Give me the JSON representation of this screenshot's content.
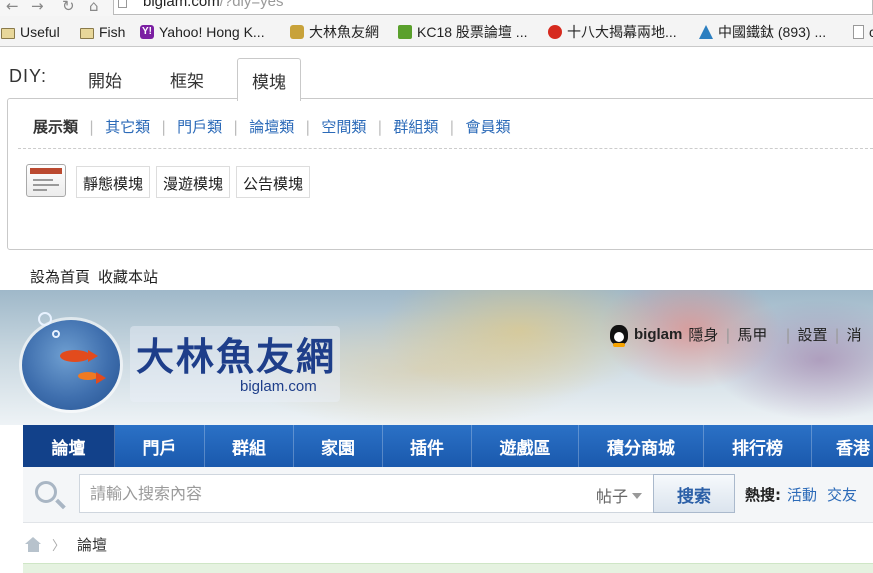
{
  "browser": {
    "url_host": "biglam.com",
    "url_rest": "/?diy=yes",
    "bookmarks": [
      {
        "icon": "folder-icon",
        "label": "Useful"
      },
      {
        "icon": "folder-icon",
        "label": "Fish"
      },
      {
        "icon": "yahoo-icon",
        "label": "Yahoo! Hong K..."
      },
      {
        "icon": "fish-site-icon",
        "label": "大林魚友網"
      },
      {
        "icon": "kc18-icon",
        "label": "KC18 股票論壇 ..."
      },
      {
        "icon": "tomato-icon",
        "label": "十八大揭幕兩地..."
      },
      {
        "icon": "ti-logo-icon",
        "label": "中國鐵鈦 (893) ..."
      },
      {
        "icon": "document-icon",
        "label": "c"
      }
    ]
  },
  "diy": {
    "label": "DIY:",
    "tabs": [
      "開始",
      "框架",
      "模塊"
    ],
    "active_tab": "模塊",
    "categories": [
      "展示類",
      "其它類",
      "門戶類",
      "論壇類",
      "空間類",
      "群組類",
      "會員類"
    ],
    "module_buttons": [
      "靜態模塊",
      "漫遊模塊",
      "公告模塊"
    ]
  },
  "toplinks": {
    "set_home": "設為首頁",
    "bookmark": "收藏本站"
  },
  "header": {
    "logo_cn": "大林魚友網",
    "logo_en": "biglam.com",
    "username": "biglam",
    "user_links": [
      "隱身",
      "馬甲",
      "設置",
      "消"
    ]
  },
  "nav": {
    "items": [
      "論壇",
      "門戶",
      "群組",
      "家園",
      "插件",
      "遊戲區",
      "積分商城",
      "排行榜",
      "香港"
    ],
    "active": "論壇"
  },
  "search": {
    "placeholder": "請輸入搜索內容",
    "type": "帖子",
    "button": "搜索",
    "hot_label": "熱搜:",
    "hot_keywords": [
      "活動",
      "交友"
    ]
  },
  "breadcrumb": {
    "current": "論壇"
  },
  "colors": {
    "nav_blue": "#1a59ad",
    "nav_active": "#12418a",
    "link_blue": "#2b6ab8"
  }
}
